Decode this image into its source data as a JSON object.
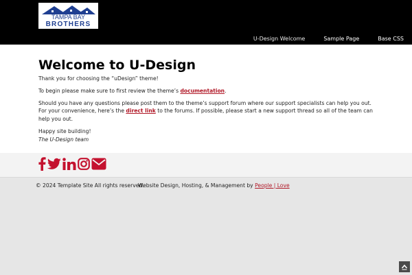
{
  "header": {
    "logo_top_text": "TAMPA BAY",
    "logo_bottom_text": "BROTHERS",
    "colors": {
      "background": "#000000",
      "logo_blue": "#1f3f91",
      "nav_text": "#ffffff"
    }
  },
  "nav": {
    "items": [
      {
        "label": "U-Design Welcome"
      },
      {
        "label": "Sample Page"
      },
      {
        "label": "Base CSS"
      }
    ]
  },
  "main": {
    "title": "Welcome to U-Design",
    "p1": "Thank you for choosing the “uDesign” theme!",
    "p2_before": "To begin please make sure to first review the theme’s ",
    "p2_link": "documentation",
    "p2_after": ".",
    "p3_line1": "Should you have any questions please post them to the theme’s support forum where our support specialists can help you out.",
    "p3_before": "For your convenience, here’s the ",
    "p3_link": "direct link",
    "p3_after": " to the forums. If possible, please start a new support thread so all of the team can help you out.",
    "p4": "Happy site building!",
    "p5": "The U-Design team",
    "colors": {
      "link": "#b01726"
    }
  },
  "social": {
    "icons": [
      "facebook-icon",
      "twitter-icon",
      "linkedin-icon",
      "instagram-icon",
      "email-icon"
    ],
    "colors": {
      "icon": "#c4122f"
    }
  },
  "footer": {
    "copyright": "© 2024 Template Site All rights reserved.",
    "credits_before": "Website Design, Hosting, & Management by ",
    "credits_link": "People | Love"
  },
  "scroll_top": {
    "icon": "chevron-up-icon"
  }
}
